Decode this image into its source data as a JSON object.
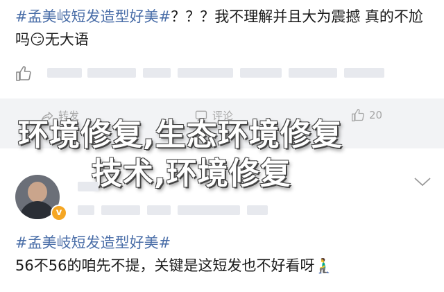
{
  "post1": {
    "topic": "#孟美岐短发造型好美#",
    "text": "？？？我不理解并且大为震撼 真的不尬吗",
    "emoji": "😏",
    "text_end": "无大语"
  },
  "actions": {
    "forward": "转发",
    "comment": "评论",
    "like_count": "20"
  },
  "watermark": {
    "line1": "环境修复,生态环境修复",
    "line2": "技术,环境修复"
  },
  "post2": {
    "topic": "#孟美岐短发造型好美#",
    "text": "56不56的咱先不提，关键是这短发也不好看呀",
    "emoji": "🧎‍♂️"
  },
  "icons": {
    "like": "thumbs-up-icon",
    "forward": "forward-icon",
    "comment": "comment-icon",
    "like_action": "like-action-icon",
    "chevron": "chevron-down-icon",
    "badge": "verified-badge-icon"
  },
  "colors": {
    "topic": "#4a6ea8",
    "action_bar": "#f2f3f5",
    "badge": "#f5a623"
  }
}
